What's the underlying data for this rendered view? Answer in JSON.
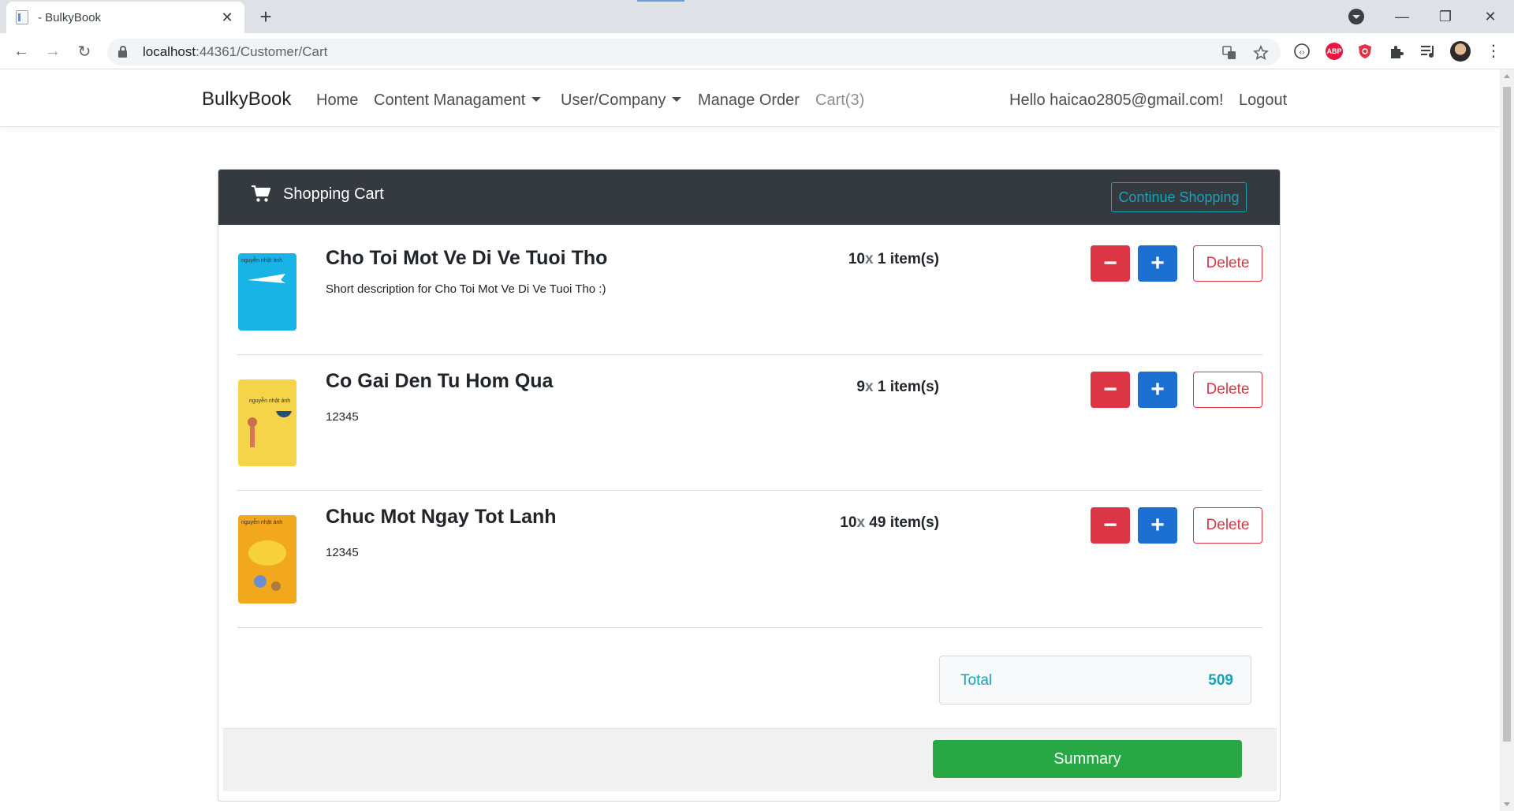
{
  "browser": {
    "tab_title": "- BulkyBook",
    "tab_close": "✕",
    "new_tab": "+",
    "url_host": "localhost",
    "url_rest": ":44361/Customer/Cart",
    "back": "←",
    "forward": "→",
    "reload": "↻",
    "window_minimize": "—",
    "window_restore": "❐",
    "window_close": "✕",
    "menu": "⋮",
    "extensions": [
      {
        "name": "abp",
        "label": "ABP",
        "color": "#e8153e"
      },
      {
        "name": "shield",
        "label": "",
        "color": "#e0334a"
      }
    ]
  },
  "nav": {
    "brand": "BulkyBook",
    "links": {
      "home": "Home",
      "content": "Content Managament",
      "user_company": "User/Company",
      "manage_order": "Manage Order",
      "cart": "Cart(3)"
    },
    "greeting": "Hello haicao2805@gmail.com!",
    "logout": "Logout"
  },
  "cart": {
    "title": "Shopping Cart",
    "continue_label": "Continue Shopping",
    "items": [
      {
        "title": "Cho Toi Mot Ve Di Ve Tuoi Tho",
        "description": "Short description for Cho Toi Mot Ve Di Ve Tuoi Tho :)",
        "price": "10",
        "times": "x",
        "quantity": "1 item(s)",
        "cover_color": "#18b4e6",
        "cover_text": "nguyễn nhật ánh"
      },
      {
        "title": "Co Gai Den Tu Hom Qua",
        "description": "12345",
        "price": "9",
        "times": "x",
        "quantity": "1 item(s)",
        "cover_color": "#f6d44a",
        "cover_text": "nguyễn nhật ánh"
      },
      {
        "title": "Chuc Mot Ngay Tot Lanh",
        "description": "12345",
        "price": "10",
        "times": "x",
        "quantity": "49 item(s)",
        "cover_color": "#f2a81c",
        "cover_text": "nguyễn nhật ánh"
      }
    ],
    "minus_label": "−",
    "plus_label": "+",
    "delete_label": "Delete",
    "total_label": "Total",
    "total_value": "509",
    "summary_label": "Summary"
  },
  "colors": {
    "danger": "#dc3545",
    "primary": "#1a6fd0",
    "info": "#17a2b8",
    "success": "#28a745",
    "header_dark": "#343a40"
  }
}
